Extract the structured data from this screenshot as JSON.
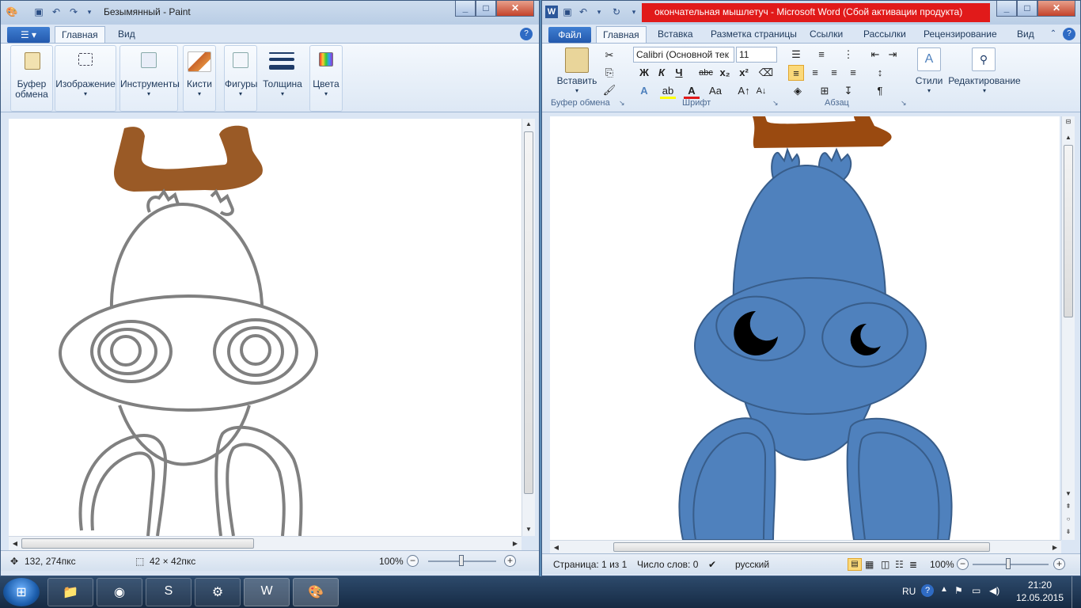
{
  "paint": {
    "title": "Безымянный - Paint",
    "tabs": [
      "Главная",
      "Вид"
    ],
    "groups": {
      "clipboard": [
        "Буфер",
        "обмена"
      ],
      "image": "Изображение",
      "tools": "Инструменты",
      "brushes": "Кисти",
      "shapes": "Фигуры",
      "size": "Толщина",
      "colors": "Цвета"
    },
    "status": {
      "cursor": "132, 274пкс",
      "selection": "42 × 42пкс",
      "zoom": "100%"
    }
  },
  "word": {
    "title": "окончательная мышлетуч  -  Microsoft Word (Сбой активации продукта)",
    "file_tab": "Файл",
    "tabs": [
      "Главная",
      "Вставка",
      "Разметка страницы",
      "Ссылки",
      "Рассылки",
      "Рецензирование",
      "Вид"
    ],
    "font_name": "Calibri (Основной тек",
    "font_size": "11",
    "paste": "Вставить",
    "styles": "Стили",
    "editing": "Редактирование",
    "group_names": [
      "Буфер обмена",
      "Шрифт",
      "Абзац"
    ],
    "format_buttons": [
      "Ж",
      "К",
      "Ч",
      "abc",
      "x₂",
      "x²"
    ],
    "status": {
      "page": "Страница: 1 из 1",
      "words": "Число слов: 0",
      "lang": "русский",
      "zoom": "100%"
    }
  },
  "taskbar": {
    "lang": "RU",
    "time": "21:20",
    "date": "12.05.2015"
  },
  "colors": {
    "accent_title": "#e11a1a",
    "brown": "#9a5a26",
    "frog_blue": "#4f81bd",
    "frog_outline": "#385d8a",
    "paint_line": "#808080"
  }
}
